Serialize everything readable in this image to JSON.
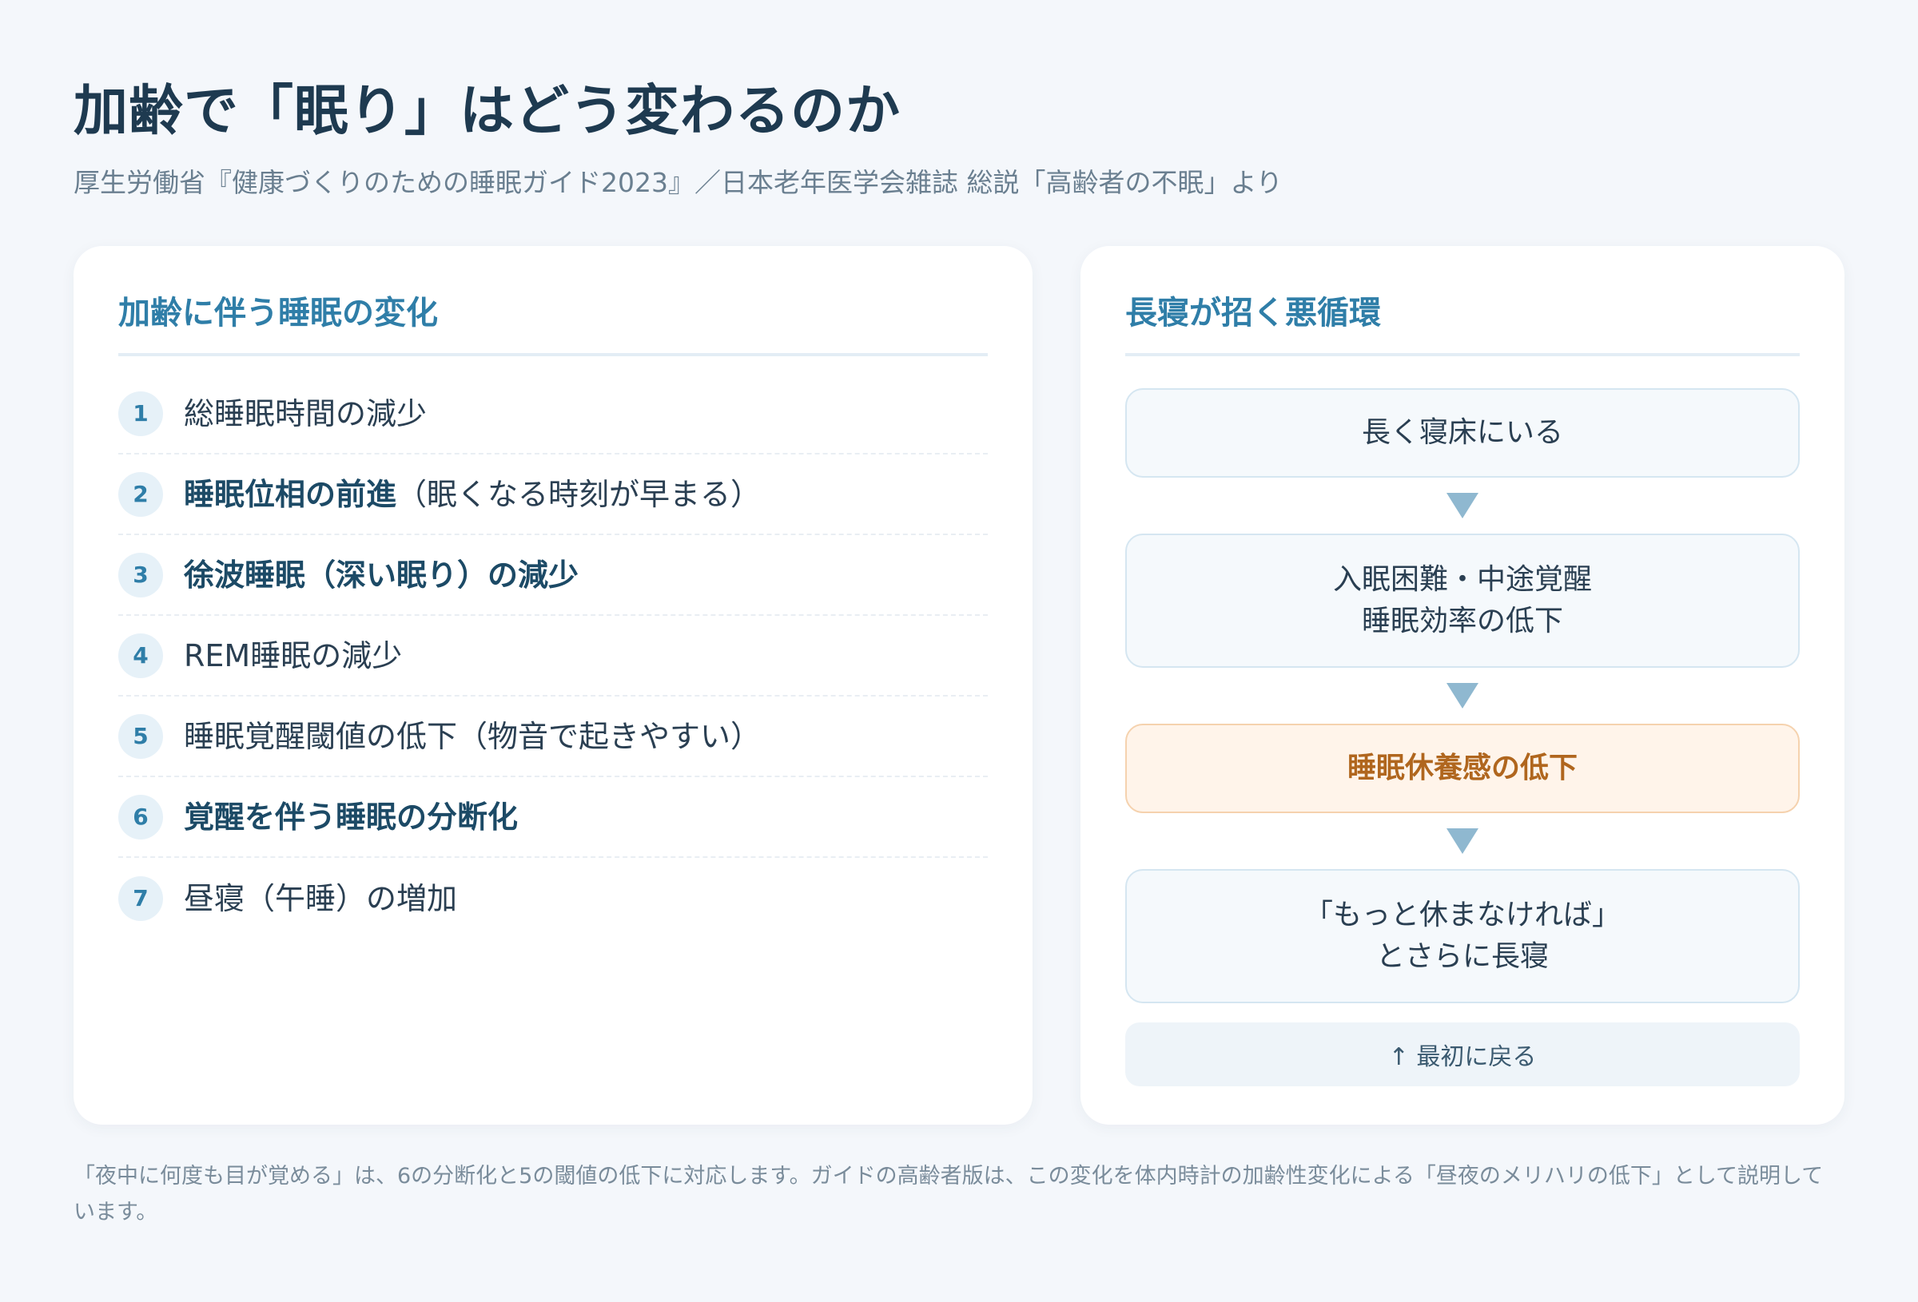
{
  "header": {
    "title": "加齢で「眠り」はどう変わるのか",
    "subtitle": "厚生労働省『健康づくりのための睡眠ガイド2023』／日本老年医学会雑誌 総説「高齢者の不眠」より"
  },
  "left_card": {
    "heading": "加齢に伴う睡眠の変化",
    "items": [
      {
        "num": "1",
        "main": "総睡眠時間の減少",
        "note": ""
      },
      {
        "num": "2",
        "main": "睡眠位相の前進",
        "note": "（眠くなる時刻が早まる）"
      },
      {
        "num": "3",
        "main": "徐波睡眠（深い眠り）の減少",
        "note": ""
      },
      {
        "num": "4",
        "main": "REM睡眠の減少",
        "note": ""
      },
      {
        "num": "5",
        "main": "睡眠覚醒閾値の低下（物音で起きやすい）",
        "note": ""
      },
      {
        "num": "6",
        "main": "覚醒を伴う睡眠の分断化",
        "note": ""
      },
      {
        "num": "7",
        "main": "昼寝（午睡）の増加",
        "note": ""
      }
    ]
  },
  "right_card": {
    "heading": "長寝が招く悪循環",
    "steps": [
      {
        "line1": "長く寝床にいる",
        "line2": ""
      },
      {
        "line1": "入眠困難・中途覚醒",
        "line2": "睡眠効率の低下"
      },
      {
        "line1": "睡眠休養感の低下",
        "line2": ""
      },
      {
        "line1": "「もっと休まなければ」",
        "line2": "とさらに長寝"
      }
    ],
    "return_label": "↑ 最初に戻る",
    "arrow_color": "#8fb8d0",
    "highlight_color": "#b0661e"
  },
  "footnote": "「夜中に何度も目が覚める」は、6の分断化と5の閾値の低下に対応します。ガイドの高齢者版は、この変化を体内時計の加齢性変化による「昼夜のメリハリの低下」として説明しています。"
}
